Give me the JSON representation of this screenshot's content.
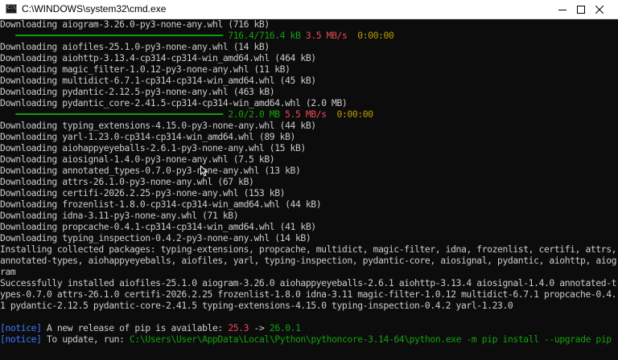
{
  "window": {
    "title": "C:\\WINDOWS\\system32\\cmd.exe",
    "icon": "cmd-icon",
    "controls": [
      "minimize-icon",
      "maximize-icon",
      "close-icon"
    ]
  },
  "lines": [
    {
      "text": "Downloading aiogram-3.26.0-py3-none-any.whl (716 kB)"
    },
    {
      "bar": "━━━━━━━━━━━━━━━━━━━━━━━━━━━━━━━━━━━━━━━━",
      "size": "716.4/716.4 kB",
      "speed": "3.5 MB/s",
      "eta": "0:00:00",
      "progress": 1.0
    },
    {
      "text": "Downloading aiofiles-25.1.0-py3-none-any.whl (14 kB)"
    },
    {
      "text": "Downloading aiohttp-3.13.4-cp314-cp314-win_amd64.whl (464 kB)"
    },
    {
      "text": "Downloading magic_filter-1.0.12-py3-none-any.whl (11 kB)"
    },
    {
      "text": "Downloading multidict-6.7.1-cp314-cp314-win_amd64.whl (45 kB)"
    },
    {
      "text": "Downloading pydantic-2.12.5-py3-none-any.whl (463 kB)"
    },
    {
      "text": "Downloading pydantic_core-2.41.5-cp314-cp314-win_amd64.whl (2.0 MB)"
    },
    {
      "bar": "━━━━━━━━━━━━━━━━━━━━━━━━━━━━━━━━━━━━━━━━",
      "size": "2.0/2.0 MB",
      "speed": "5.5 MB/s",
      "eta": "0:00:00",
      "progress": 1.0
    },
    {
      "text": "Downloading typing_extensions-4.15.0-py3-none-any.whl (44 kB)"
    },
    {
      "text": "Downloading yarl-1.23.0-cp314-cp314-win_amd64.whl (89 kB)"
    },
    {
      "text": "Downloading aiohappyeyeballs-2.6.1-py3-none-any.whl (15 kB)"
    },
    {
      "text": "Downloading aiosignal-1.4.0-py3-none-any.whl (7.5 kB)"
    },
    {
      "text": "Downloading annotated_types-0.7.0-py3-none-any.whl (13 kB)"
    },
    {
      "text": "Downloading attrs-26.1.0-py3-none-any.whl (67 kB)"
    },
    {
      "text": "Downloading certifi-2026.2.25-py3-none-any.whl (153 kB)"
    },
    {
      "text": "Downloading frozenlist-1.8.0-cp314-cp314-win_amd64.whl (44 kB)"
    },
    {
      "text": "Downloading idna-3.11-py3-none-any.whl (71 kB)"
    },
    {
      "text": "Downloading propcache-0.4.1-cp314-cp314-win_amd64.whl (41 kB)"
    },
    {
      "text": "Downloading typing_inspection-0.4.2-py3-none-any.whl (14 kB)"
    },
    {
      "text": "Installing collected packages: typing-extensions, propcache, multidict, magic-filter, idna, frozenlist, certifi, attrs, annotated-types, aiohappyeyeballs, aiofiles, yarl, typing-inspection, pydantic-core, aiosignal, pydantic, aiohttp, aiogram"
    },
    {
      "text": "Successfully installed aiofiles-25.1.0 aiogram-3.26.0 aiohappyeyeballs-2.6.1 aiohttp-3.13.4 aiosignal-1.4.0 annotated-types-0.7.0 attrs-26.1.0 certifi-2026.2.25 frozenlist-1.8.0 idna-3.11 magic-filter-1.0.12 multidict-6.7.1 propcache-0.4.1 pydantic-2.12.5 pydantic-core-2.41.5 typing-extensions-4.15.0 typing-inspection-0.4.2 yarl-1.23.0"
    },
    {
      "text": ""
    },
    {
      "notice": "[notice]",
      "text": "A new release of pip is available:",
      "old": "25.3",
      "arrow": "->",
      "new": "26.0.1"
    },
    {
      "notice": "[notice]",
      "text": "To update, run:",
      "cmd": "C:\\Users\\User\\AppData\\Local\\Python\\pythoncore-3.14-64\\python.exe -m pip install --upgrade pip"
    }
  ],
  "colors": {
    "background": "#0c0c0c",
    "text": "#cccccc",
    "progress_bar": "#13a10e",
    "speed": "#e74856",
    "eta": "#c19c00",
    "notice": "#3b78ff",
    "old_version": "#e74856",
    "new_version": "#13a10e",
    "command": "#13a10e"
  }
}
